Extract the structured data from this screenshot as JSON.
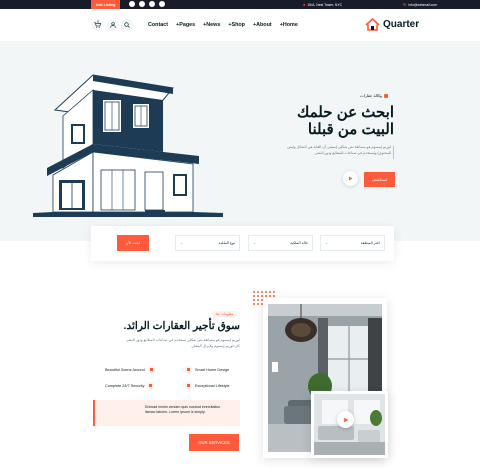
{
  "topbar": {
    "cta_label": "Add Listing",
    "social_icons": [
      "facebook-icon",
      "linkedin-icon",
      "twitter-icon",
      "facebook-icon"
    ],
    "address": "15/A, Nest Tower, NYC",
    "email": "info@webmail.com"
  },
  "header": {
    "cart_count": "0",
    "nav": [
      "Contact",
      "+Pages",
      "+News",
      "+Shop",
      "+About",
      "+Home"
    ],
    "logo_text": "Quarter"
  },
  "hero": {
    "eyebrow": "وكالة عقارات",
    "title": "ابحث عن حلمك البيت من قبلنا",
    "description": "لوريم إيبسوم هو ببساطة نص شكلي (بمعنى أن الغاية هي الشكل وليس المحتوى) ويُستخدم في صناعات المطابع ودور النشر.",
    "button_label": "استكشف"
  },
  "search": {
    "select_1": "اختر المنطقة",
    "select_2": "حالة الملكية",
    "select_3": "نوع الملكية",
    "button_label": "ابحث الآن"
  },
  "about": {
    "badge": "معلومات عنا",
    "title": "سوق تأجير العقارات الرائد.",
    "description": "لوريم إيبسوم هو ببساطة نص شكلي يستخدم في صناعات المطابع ودور النشر. كان لوريم إيبسوم ولايزال المعيار.",
    "features": [
      "Smart Home Design",
      "Beautiful Scene Around",
      "Exceptional Lifestyle",
      "Complete 24/7 Security"
    ],
    "quote_line1": "Enimad minim veniam quis nostrud exercitation",
    "quote_line2": "llamco laboris. Lorem Ipsum is simply.",
    "services_button": "OUR SERVICES"
  },
  "colors": {
    "accent": "#ff5a3c",
    "dark": "#171b2a",
    "hero_bg": "#f2f6f7"
  }
}
